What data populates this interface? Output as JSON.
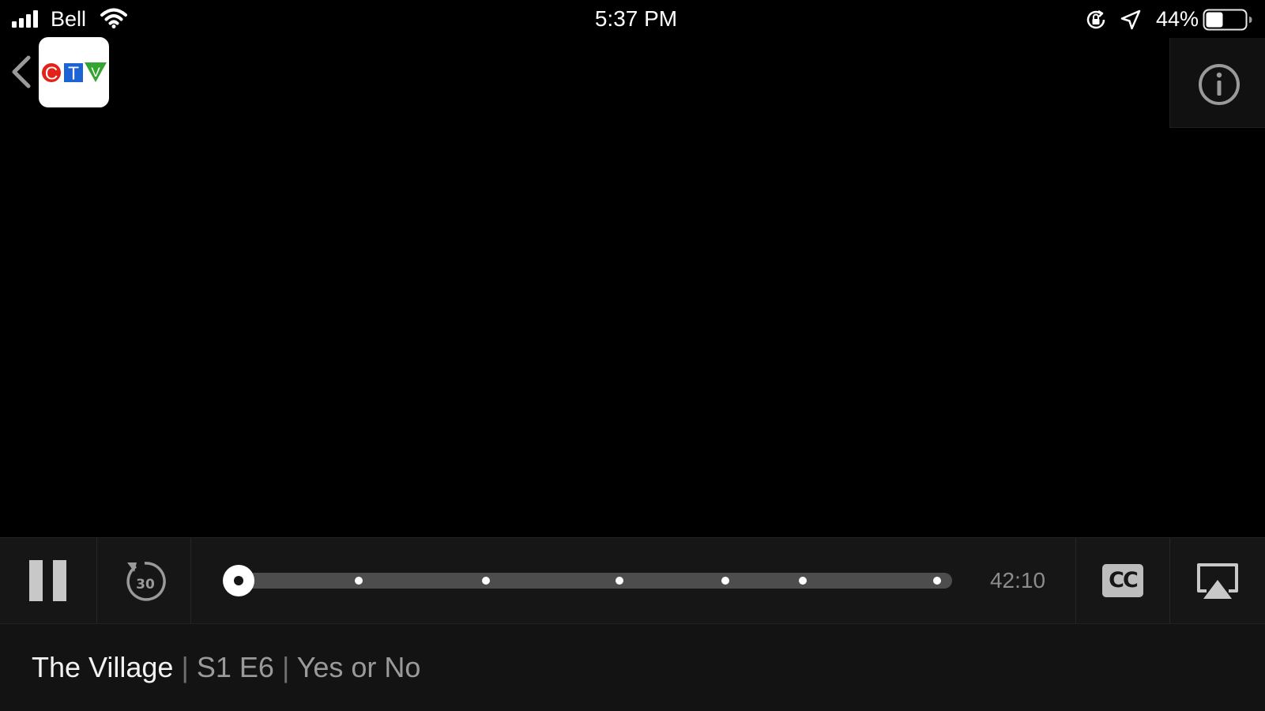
{
  "status_bar": {
    "carrier": "Bell",
    "time": "5:37 PM",
    "battery_percent": "44%",
    "battery_level": 0.44,
    "signal_icon": "cellular-signal-icon",
    "wifi_icon": "wifi-icon",
    "rotation_lock_icon": "rotation-lock-icon",
    "location_icon": "location-arrow-icon"
  },
  "header": {
    "back_icon": "chevron-left-icon",
    "logo_letters": [
      "C",
      "T",
      "V"
    ],
    "logo_colors": {
      "c": "#e2231a",
      "t": "#1e63d6",
      "v": "#35a531"
    },
    "info_icon": "info-circle-icon"
  },
  "player": {
    "play_state": "playing",
    "pause_icon": "pause-icon",
    "rewind_label": "30",
    "rewind_icon": "rewind-30-icon",
    "progress": 0.0,
    "chapter_markers": [
      0.17,
      0.35,
      0.54,
      0.69,
      0.8,
      0.99
    ],
    "duration": "42:10",
    "cc_label": "CC",
    "airplay_icon": "airplay-icon"
  },
  "title_bar": {
    "show": "The Village",
    "separator": "|",
    "episode": "S1 E6",
    "episode_title": "Yes or No"
  }
}
